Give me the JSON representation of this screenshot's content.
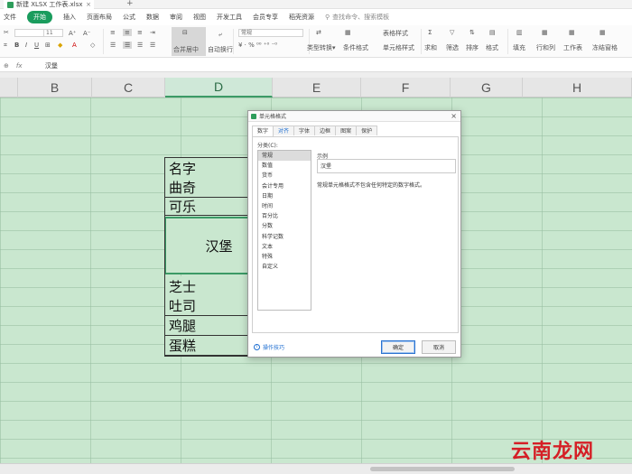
{
  "window": {
    "doc_tab": "新建 XLSX 工作表.xlsx",
    "new_tab": "+"
  },
  "menu": {
    "items": [
      "文件",
      "开始",
      "插入",
      "页面布局",
      "公式",
      "数据",
      "审阅",
      "视图",
      "开发工具",
      "会员专享",
      "稻壳资源"
    ],
    "active": "开始",
    "search": "查找命令、搜索模板"
  },
  "ribbon": {
    "font_size": "11",
    "merge_label": "合并居中",
    "wrap_label": "自动换行",
    "number_format": "常规",
    "cond_format": "条件格式",
    "table_style": "表格样式",
    "cell_style": "单元格样式",
    "sum_label": "求和",
    "filter_label": "筛选",
    "sort_label": "排序",
    "format_label": "格式",
    "fill_label": "填充",
    "row_col_label": "行和列",
    "worksheet_label": "工作表",
    "freeze_label": "冻结窗格"
  },
  "formula_bar": {
    "fx": "fx",
    "value": "汉堡"
  },
  "columns": [
    "B",
    "C",
    "D",
    "E",
    "F",
    "G",
    "H"
  ],
  "selected_column": "D",
  "cells": [
    "名字",
    "曲奇",
    "可乐",
    "汉堡",
    "芝士",
    "吐司",
    "鸡腿",
    "蛋糕"
  ],
  "dialog": {
    "title": "单元格格式",
    "close": "×",
    "tabs": [
      "数字",
      "对齐",
      "字体",
      "边框",
      "图案",
      "保护"
    ],
    "active_tab": "数字",
    "category_label": "分类(C):",
    "categories": [
      "常规",
      "数值",
      "货币",
      "会计专用",
      "日期",
      "时间",
      "百分比",
      "分数",
      "科学记数",
      "文本",
      "特殊",
      "自定义"
    ],
    "selected_category": "常规",
    "sample_label": "示例",
    "sample_value": "汉堡",
    "description": "常规单元格格式不包含任何特定的数字格式。",
    "tips": "操作技巧",
    "ok": "确定",
    "cancel": "取消"
  },
  "watermark": {
    "brand": "云南龙网"
  },
  "colors": {
    "accent": "#1a9c5d",
    "sheet_bg": "#c9e7cf",
    "brand_red": "#d51f26"
  }
}
